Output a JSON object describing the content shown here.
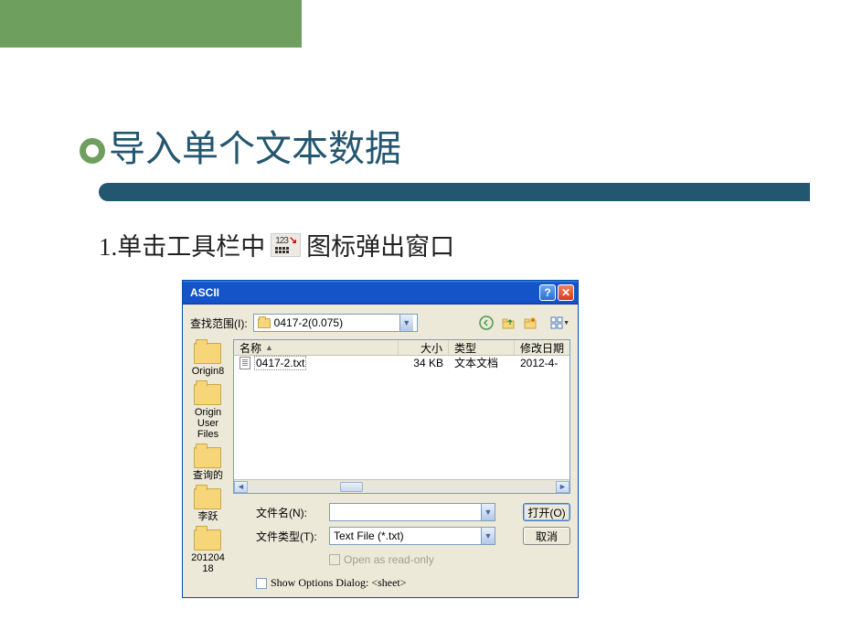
{
  "slide": {
    "title": "导入单个文本数据",
    "step_prefix": "1.单击工具栏中",
    "step_suffix": "图标弹出窗口"
  },
  "dialog": {
    "title": "ASCII",
    "look_in_label": "查找范围(I):",
    "look_in_value": "0417-2(0.075)",
    "columns": {
      "name": "名称",
      "size": "大小",
      "type": "类型",
      "date": "修改日期"
    },
    "places": [
      "Origin8",
      "Origin User Files",
      "查询的",
      "李跃",
      "20120418"
    ],
    "files": [
      {
        "name": "0417-2.txt",
        "size": "34 KB",
        "type": "文本文档",
        "date": "2012-4-"
      }
    ],
    "filename_label": "文件名(N):",
    "filename_value": "",
    "filetype_label": "文件类型(T):",
    "filetype_value": "Text File (*.txt)",
    "readonly_label": "Open as read-only",
    "open_btn": "打开(O)",
    "cancel_btn": "取消",
    "options_label": "Show Options Dialog: <sheet>"
  }
}
